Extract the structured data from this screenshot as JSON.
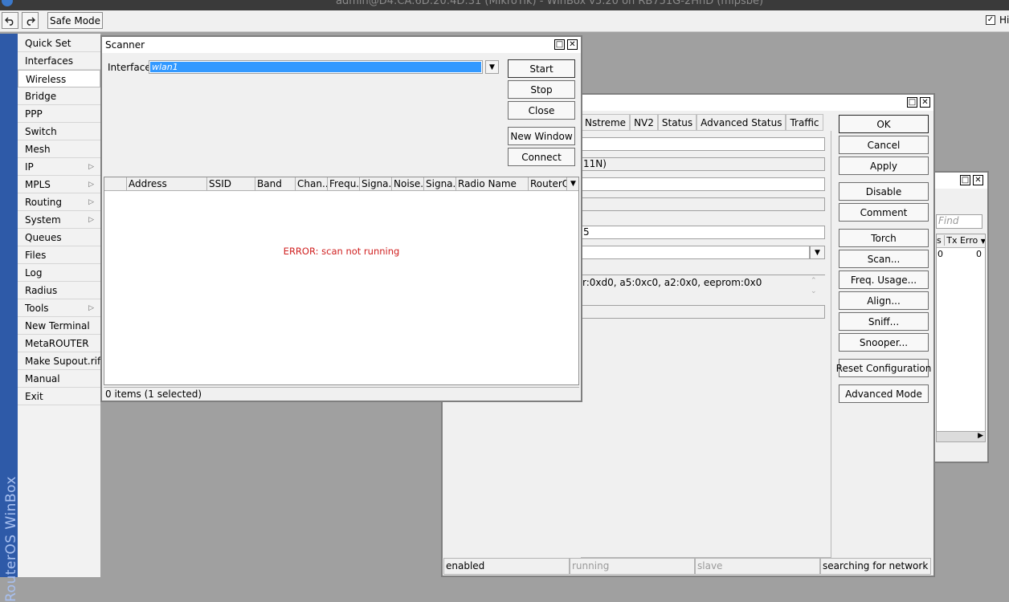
{
  "window_title": "admin@D4:CA:6D:20:4D:31 (MikroTik) - WinBox v5.20 on RB751G-2HnD (mipsbe)",
  "toolbar": {
    "undo_icon": "undo-icon",
    "redo_icon": "redo-icon",
    "safe_mode_label": "Safe Mode",
    "hide_label": "Hid",
    "hide_checked": "✓"
  },
  "brand": "RouterOS WinBox",
  "menu": [
    {
      "label": "Quick Set",
      "submenu": ""
    },
    {
      "label": "Interfaces",
      "submenu": ""
    },
    {
      "label": "Wireless",
      "submenu": ""
    },
    {
      "label": "Bridge",
      "submenu": ""
    },
    {
      "label": "PPP",
      "submenu": ""
    },
    {
      "label": "Switch",
      "submenu": ""
    },
    {
      "label": "Mesh",
      "submenu": ""
    },
    {
      "label": "IP",
      "submenu": "▷"
    },
    {
      "label": "MPLS",
      "submenu": "▷"
    },
    {
      "label": "Routing",
      "submenu": "▷"
    },
    {
      "label": "System",
      "submenu": "▷"
    },
    {
      "label": "Queues",
      "submenu": ""
    },
    {
      "label": "Files",
      "submenu": ""
    },
    {
      "label": "Log",
      "submenu": ""
    },
    {
      "label": "Radius",
      "submenu": ""
    },
    {
      "label": "Tools",
      "submenu": "▷"
    },
    {
      "label": "New Terminal",
      "submenu": ""
    },
    {
      "label": "MetaROUTER",
      "submenu": ""
    },
    {
      "label": "Make Supout.rif",
      "submenu": ""
    },
    {
      "label": "Manual",
      "submenu": ""
    },
    {
      "label": "Exit",
      "submenu": ""
    }
  ],
  "scanner": {
    "title": "Scanner",
    "interface_label": "Interface:",
    "interface_value": "wlan1",
    "buttons": {
      "start": "Start",
      "stop": "Stop",
      "close": "Close",
      "new_window": "New Window",
      "connect": "Connect"
    },
    "columns": [
      "Address",
      "SSID",
      "Band",
      "Chan...",
      "Frequ...",
      "Signa...",
      "Noise...",
      "Signa...",
      "Radio Name",
      "RouterO..."
    ],
    "error": "ERROR: scan not running",
    "status": "0 items (1 selected)"
  },
  "interface_window": {
    "tabs": [
      "Nstreme",
      "NV2",
      "Status",
      "Advanced Status",
      "Traffic"
    ],
    "fields": {
      "band_fragment": "11N)",
      "number_fragment": "5",
      "hw_info": "r:0xd0, a5:0xc0, a2:0x0, eeprom:0x0"
    },
    "buttons": [
      "OK",
      "Cancel",
      "Apply",
      "Disable",
      "Comment",
      "Torch",
      "Scan...",
      "Freq. Usage...",
      "Align...",
      "Sniff...",
      "Snooper...",
      "Reset Configuration",
      "Advanced Mode"
    ],
    "status": [
      "enabled",
      "running",
      "slave",
      "searching for network"
    ]
  },
  "back_window": {
    "find_placeholder": "Find",
    "col_partial": "s",
    "col_tx_errors": "Tx Erro",
    "row_value_left": "0",
    "row_value_right": "0"
  },
  "colors": {
    "brand_strip": "#2e5aa8",
    "selection": "#3399ff",
    "error_text": "#d02020"
  }
}
